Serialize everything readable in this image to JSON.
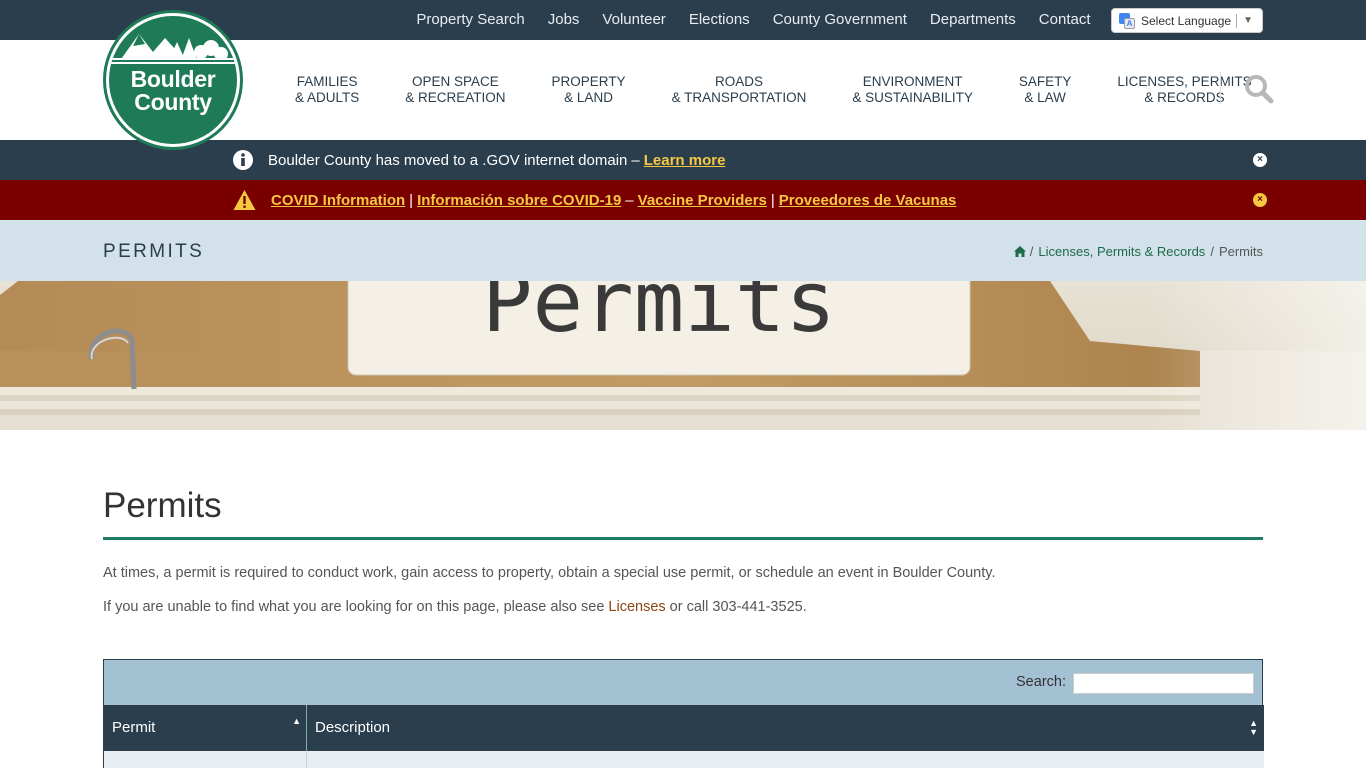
{
  "topnav": [
    "Property Search",
    "Jobs",
    "Volunteer",
    "Elections",
    "County Government",
    "Departments",
    "Contact"
  ],
  "language": {
    "label": "Select Language",
    "arrow": "▼"
  },
  "logo": {
    "line1": "Boulder",
    "line2": "County"
  },
  "mainnav": [
    {
      "l1": "FAMILIES",
      "l2": "& ADULTS"
    },
    {
      "l1": "OPEN SPACE",
      "l2": "& RECREATION"
    },
    {
      "l1": "PROPERTY",
      "l2": "& LAND"
    },
    {
      "l1": "ROADS",
      "l2": "& TRANSPORTATION"
    },
    {
      "l1": "ENVIRONMENT",
      "l2": "& SUSTAINABILITY"
    },
    {
      "l1": "SAFETY",
      "l2": "& LAW"
    },
    {
      "l1": "LICENSES, PERMITS",
      "l2": "& RECORDS"
    }
  ],
  "alert1": {
    "text": "Boulder County has moved to a .GOV internet domain",
    "dash": "–",
    "link": "Learn more",
    "close": "×"
  },
  "alert2": {
    "link1": "COVID Information",
    "pipe1": "|",
    "link2": "Información sobre COVID-19",
    "dash": "–",
    "link3": "Vaccine Providers",
    "pipe2": "|",
    "link4": "Proveedores de Vacunas",
    "close": "×"
  },
  "titleband": {
    "title": "PERMITS"
  },
  "breadcrumb": {
    "sep1": "/",
    "link": "Licenses, Permits & Records",
    "sep2": "/",
    "current": "Permits"
  },
  "banner": {
    "text": "Permits"
  },
  "content": {
    "heading": "Permits",
    "p1": "At times, a permit is required to conduct work, gain access to property, obtain a special use permit, or schedule an event in Boulder County.",
    "p2_before": "If you are unable to find what you are looking for on this page, please also see ",
    "p2_link": "Licenses",
    "p2_after": " or call 303-441-3525."
  },
  "table": {
    "search_label": "Search:",
    "col1": "Permit",
    "col2": "Description",
    "sort_asc": "▲",
    "sort_both": "▲▼"
  },
  "colors": {
    "dark": "#2b3e4d",
    "green": "#1f7a58",
    "covid_red": "#7a0000",
    "link_yellow": "#f5c842",
    "band": "#d3e1ea",
    "table_header_bg": "#a4c0d3"
  }
}
